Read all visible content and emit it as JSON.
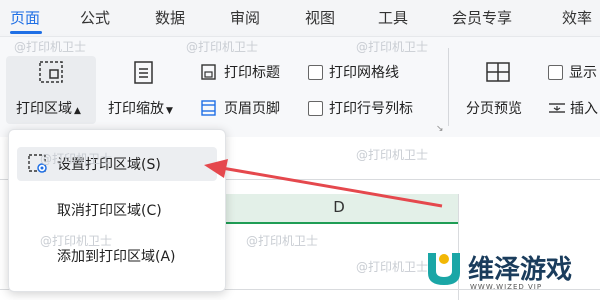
{
  "tabs": [
    "页面",
    "公式",
    "数据",
    "审阅",
    "视图",
    "工具",
    "会员专享",
    "效率"
  ],
  "watermark": "@打印机卫士",
  "ribbon": {
    "print_area": "打印区域",
    "print_scale": "打印缩放",
    "print_titles": "打印标题",
    "header_footer": "页眉页脚",
    "print_gridlines": "打印网格线",
    "print_row_col_labels": "打印行号列标",
    "page_break_preview": "分页预览",
    "show": "显示",
    "insert": "插入"
  },
  "sheet": {
    "column_label": "D"
  },
  "dropdown": {
    "set_area": "设置打印区域(S)",
    "cancel_area": "取消打印区域(C)",
    "add_area": "添加到打印区域(A)"
  },
  "brand": {
    "name": "维泽游戏",
    "url": "WWW.WIZED VIP"
  },
  "colors": {
    "accent": "#1f6fe5",
    "arrow": "#e5484d",
    "brand_teal": "#1aa6a6",
    "column_header": "#e3f0e8"
  }
}
